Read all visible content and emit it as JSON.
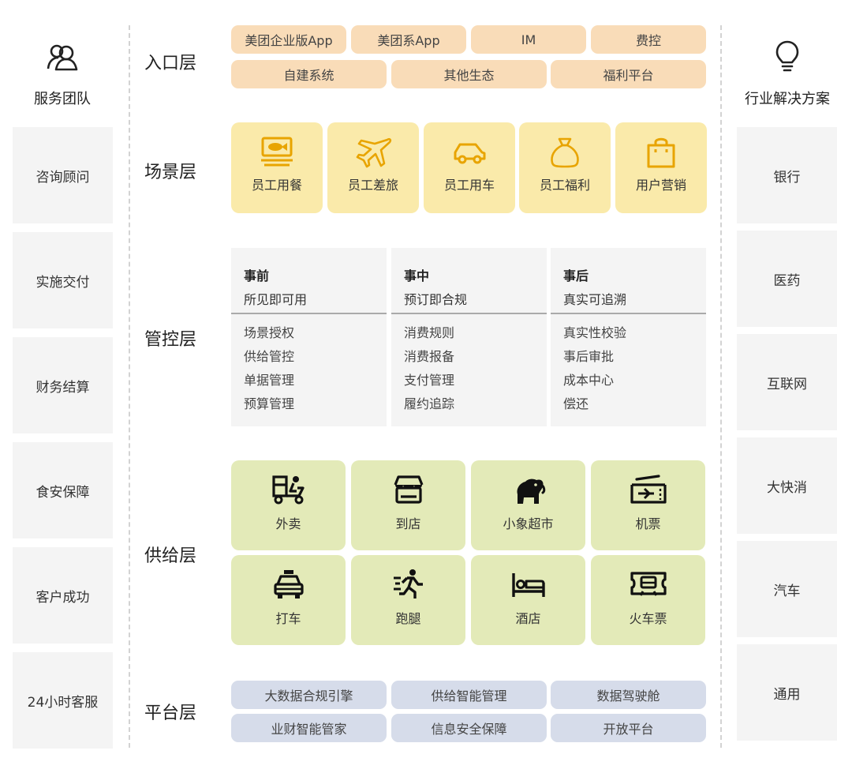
{
  "left": {
    "title": "服务团队",
    "icon": "team-icon",
    "items": [
      "咨询顾问",
      "实施交付",
      "财务结算",
      "食安保障",
      "客户成功",
      "24小时客服"
    ]
  },
  "right": {
    "title": "行业解决方案",
    "icon": "lightbulb-icon",
    "items": [
      "银行",
      "医药",
      "互联网",
      "大快消",
      "汽车",
      "通用"
    ]
  },
  "layers": {
    "entry": {
      "label": "入口层",
      "row1": [
        "美团企业版App",
        "美团系App",
        "IM",
        "费控"
      ],
      "row2": [
        "自建系统",
        "其他生态",
        "福利平台"
      ]
    },
    "scene": {
      "label": "场景层",
      "items": [
        {
          "label": "员工用餐",
          "icon": "meal-icon"
        },
        {
          "label": "员工差旅",
          "icon": "airplane-icon"
        },
        {
          "label": "员工用车",
          "icon": "car-icon"
        },
        {
          "label": "员工福利",
          "icon": "gift-bag-icon"
        },
        {
          "label": "用户营销",
          "icon": "shopping-bag-icon"
        }
      ]
    },
    "control": {
      "label": "管控层",
      "columns": [
        {
          "title": "事前",
          "subtitle": "所见即可用",
          "items": [
            "场景授权",
            "供给管控",
            "单据管理",
            "预算管理"
          ]
        },
        {
          "title": "事中",
          "subtitle": "预订即合规",
          "items": [
            "消费规则",
            "消费报备",
            "支付管理",
            "履约追踪"
          ]
        },
        {
          "title": "事后",
          "subtitle": "真实可追溯",
          "items": [
            "真实性校验",
            "事后审批",
            "成本中心",
            "偿还"
          ]
        }
      ]
    },
    "supply": {
      "label": "供给层",
      "items": [
        {
          "label": "外卖",
          "icon": "delivery-icon"
        },
        {
          "label": "到店",
          "icon": "store-icon"
        },
        {
          "label": "小象超市",
          "icon": "elephant-icon"
        },
        {
          "label": "机票",
          "icon": "flight-ticket-icon"
        },
        {
          "label": "打车",
          "icon": "taxi-icon"
        },
        {
          "label": "跑腿",
          "icon": "runner-icon"
        },
        {
          "label": "酒店",
          "icon": "bed-icon"
        },
        {
          "label": "火车票",
          "icon": "train-ticket-icon"
        }
      ]
    },
    "platform": {
      "label": "平台层",
      "row1": [
        "大数据合规引擎",
        "供给智能管理",
        "数据驾驶舱"
      ],
      "row2": [
        "业财智能管家",
        "信息安全保障",
        "开放平台"
      ]
    }
  },
  "colors": {
    "entry": "#f9dcb8",
    "scene": "#faeaaa",
    "scene_icon": "#e8a400",
    "control": "#f4f4f4",
    "supply": "#e3eab8",
    "platform": "#d6dcea",
    "side": "#f4f4f4"
  }
}
